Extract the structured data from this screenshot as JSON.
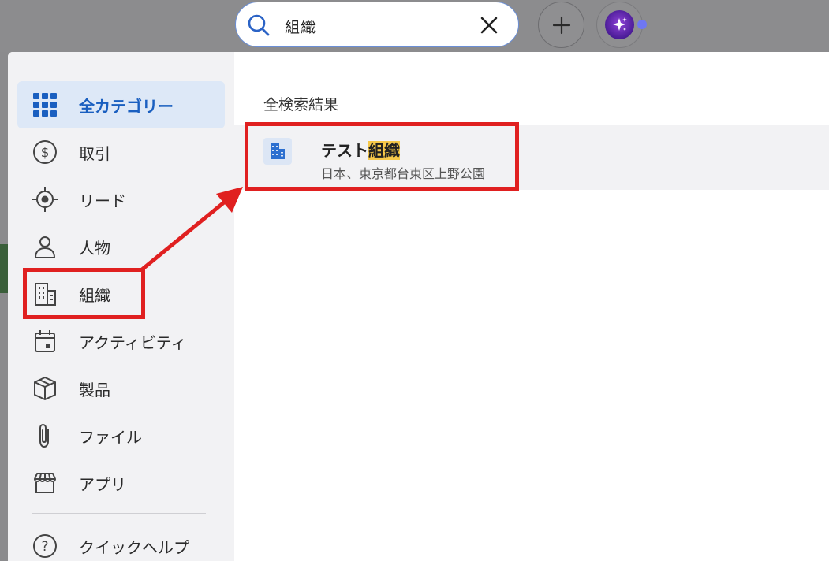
{
  "search": {
    "value": "組織"
  },
  "sidebar": {
    "items": [
      {
        "label": "全カテゴリー",
        "icon": "grid-icon",
        "active": true
      },
      {
        "label": "取引",
        "icon": "dollar-circle-icon"
      },
      {
        "label": "リード",
        "icon": "target-icon"
      },
      {
        "label": "人物",
        "icon": "person-icon"
      },
      {
        "label": "組織",
        "icon": "building-icon"
      },
      {
        "label": "アクティビティ",
        "icon": "calendar-icon"
      },
      {
        "label": "製品",
        "icon": "box-icon"
      },
      {
        "label": "ファイル",
        "icon": "paperclip-icon"
      },
      {
        "label": "アプリ",
        "icon": "store-icon"
      },
      {
        "label": "クイックヘルプ",
        "icon": "help-icon"
      }
    ]
  },
  "results": {
    "heading": "全検索結果",
    "items": [
      {
        "title_prefix": "テスト",
        "title_highlight": "組織",
        "subtitle": "日本、東京都台東区上野公園",
        "icon": "building-icon"
      }
    ]
  },
  "colors": {
    "accent": "#1a5fc0",
    "highlight": "#f7c94a",
    "annotation": "#e02020"
  }
}
